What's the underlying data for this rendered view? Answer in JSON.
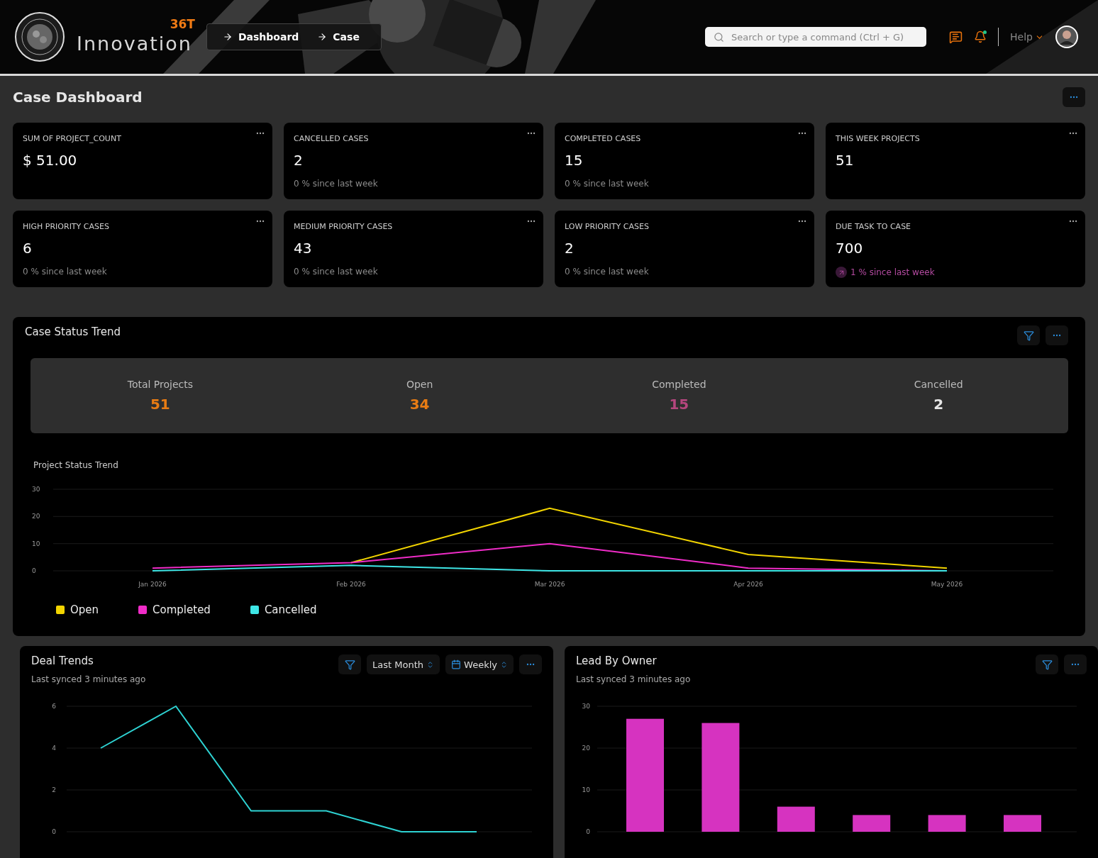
{
  "header": {
    "logo": {
      "wordmark": "Innovation",
      "superscript": "36T"
    },
    "breadcrumbs": [
      "Dashboard",
      "Case"
    ],
    "search": {
      "placeholder": "Search or type a command (Ctrl + G)"
    },
    "notifications": {
      "unread": true
    },
    "help": "Help"
  },
  "page_title": "Case Dashboard",
  "kpi_cards": [
    {
      "title": "SUM OF PROJECT_COUNT",
      "value": "$ 51.00",
      "kind": "plain"
    },
    {
      "title": "CANCELLED CASES",
      "value": "2",
      "change": "0 % since last week",
      "kind": "flat"
    },
    {
      "title": "COMPLETED CASES",
      "value": "15",
      "change": "0 % since last week",
      "kind": "flat"
    },
    {
      "title": "THIS WEEK PROJECTS",
      "value": "51",
      "kind": "plain"
    },
    {
      "title": "HIGH PRIORITY CASES",
      "value": "6",
      "change": "0 % since last week",
      "kind": "flat"
    },
    {
      "title": "MEDIUM PRIORITY CASES",
      "value": "43",
      "change": "0 % since last week",
      "kind": "flat"
    },
    {
      "title": "LOW PRIORITY CASES",
      "value": "2",
      "change": "0 % since last week",
      "kind": "flat"
    },
    {
      "title": "DUE TASK TO CASE",
      "value": "700",
      "change": "1 % since last week",
      "kind": "up"
    }
  ],
  "case_status_trend": {
    "title": "Case Status Trend",
    "stats": [
      {
        "label": "Total Projects",
        "value": "51",
        "color": "#e87c14"
      },
      {
        "label": "Open",
        "value": "34",
        "color": "#e87c14"
      },
      {
        "label": "Completed",
        "value": "15",
        "color": "#b5467e"
      },
      {
        "label": "Cancelled",
        "value": "2",
        "color": "#e6e6e6"
      }
    ],
    "chart_data": {
      "type": "line",
      "title": "Project Status Trend",
      "categories": [
        "Jan 2026",
        "Feb 2026",
        "Mar 2026",
        "Apr 2026",
        "May 2026"
      ],
      "ylim": [
        0,
        30
      ],
      "yticks": [
        0,
        10,
        20,
        30
      ],
      "series": [
        {
          "name": "Open",
          "color": "#f2d400",
          "values": [
            null,
            3,
            23,
            6,
            1
          ]
        },
        {
          "name": "Completed",
          "color": "#f02cc8",
          "values": [
            1,
            3,
            10,
            1,
            0
          ]
        },
        {
          "name": "Cancelled",
          "color": "#3ee6e6",
          "values": [
            0,
            2,
            0,
            0,
            0
          ]
        }
      ]
    }
  },
  "deal_trends": {
    "title": "Deal Trends",
    "subtitle": "Last synced 3 minutes ago",
    "period": "Last Month",
    "interval": "Weekly",
    "chart_data": {
      "type": "line",
      "ylim": [
        0,
        6
      ],
      "yticks": [
        0,
        2,
        4,
        6
      ],
      "series": [
        {
          "color": "#2ed3d3",
          "values": [
            4,
            6,
            1,
            1,
            0,
            0
          ]
        }
      ]
    }
  },
  "lead_by_owner": {
    "title": "Lead By Owner",
    "subtitle": "Last synced 3 minutes ago",
    "chart_data": {
      "type": "bar",
      "ylim": [
        0,
        30
      ],
      "yticks": [
        0,
        10,
        20,
        30
      ],
      "series": [
        {
          "color": "#d633c0",
          "values": [
            27,
            26,
            6,
            4,
            4,
            4
          ]
        }
      ]
    }
  }
}
